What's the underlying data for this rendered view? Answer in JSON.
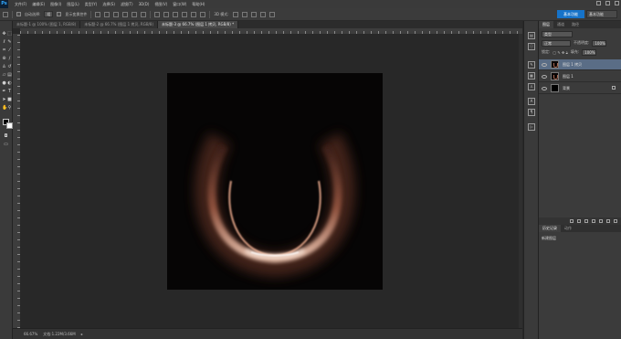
{
  "app": {
    "logo": "Ps",
    "menu": [
      "文件(F)",
      "编辑(E)",
      "图像(I)",
      "图层(L)",
      "类型(Y)",
      "选择(S)",
      "滤镜(T)",
      "3D(D)",
      "视图(V)",
      "窗口(W)",
      "帮助(H)"
    ]
  },
  "options_bar": {
    "auto_select_label": "自动选择:",
    "auto_select_value": "组",
    "transform_label": "显示变换控件",
    "mode_3d": "3D 模式:",
    "workspace_button": "基本功能",
    "workspace_select": "基本功能"
  },
  "tabs": [
    {
      "label": "未标题-1 @ 100% (图层 1, RGB/8)",
      "active": false
    },
    {
      "label": "未标题-2 @ 66.7% (图层 1 拷贝, RGB/8)",
      "active": false
    },
    {
      "label": "未标题-3 @ 66.7% (图层 1 拷贝, RGB/8) *",
      "active": true
    }
  ],
  "status_bar": {
    "zoom": "66.67%",
    "doc_info": "文档:1.22M/3.66M"
  },
  "layers_panel": {
    "tabs": [
      "图层",
      "通道",
      "路径"
    ],
    "kind_select": "类型",
    "blend_mode": "正常",
    "opacity_label": "不透明度:",
    "opacity_value": "100%",
    "lock_label": "锁定:",
    "fill_label": "填充:",
    "fill_value": "100%",
    "layers": [
      {
        "name": "图层 1 拷贝",
        "selected": true
      },
      {
        "name": "图层 1",
        "selected": false
      },
      {
        "name": "背景",
        "selected": false,
        "locked": true
      }
    ]
  },
  "history_panel": {
    "tabs": [
      "历史记录",
      "动作"
    ],
    "item": "新建图层"
  },
  "colors": {
    "foreground": "#000000",
    "background": "#ffffff",
    "accent": "#1673c9",
    "glow": "#e8a27d"
  }
}
